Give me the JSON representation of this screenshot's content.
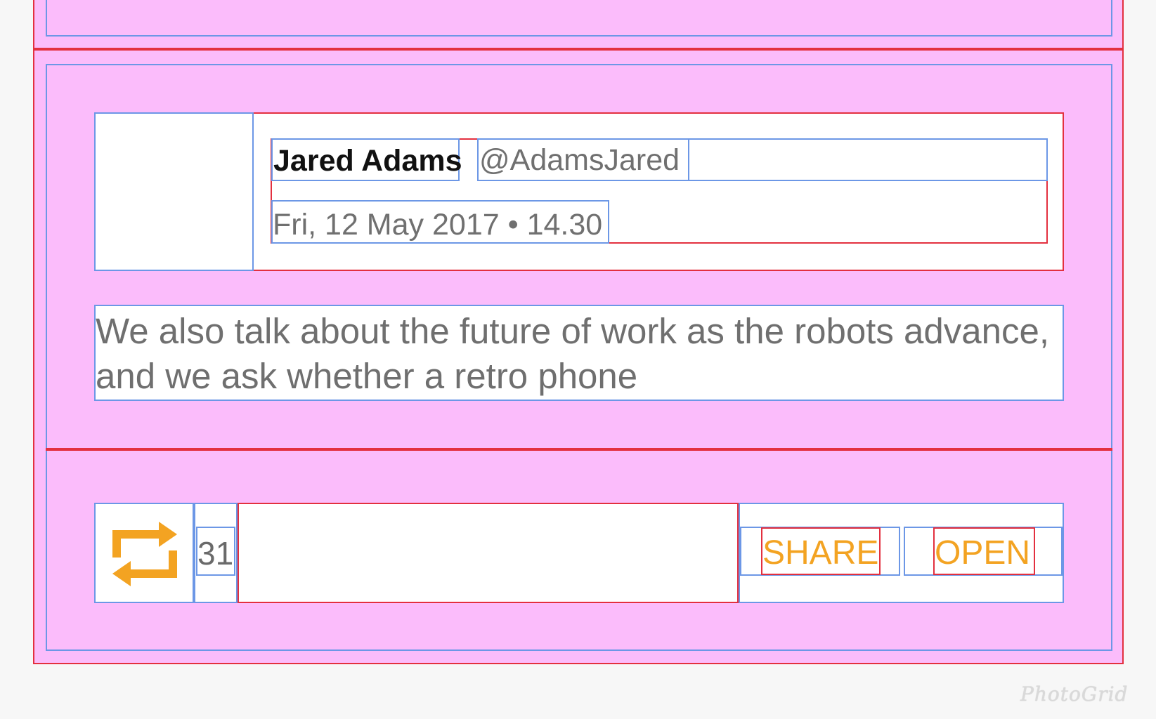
{
  "card": {
    "author_name": "Jared Adams",
    "author_handle": "@AdamsJared",
    "timestamp": "Fri, 12 May 2017 • 14.30",
    "body": "We also talk about the future of work as the robots advance, and we ask whether a retro phone",
    "retweet_count": "31",
    "share_label": "SHARE",
    "open_label": "OPEN"
  },
  "watermark": "PhotoGrid",
  "colors": {
    "overlay_pink": "#fbbcfb",
    "outline_red": "#e3303f",
    "outline_blue": "#6c97e6",
    "accent_orange": "#f3a322"
  },
  "icons": {
    "retweet": "retweet-icon"
  }
}
